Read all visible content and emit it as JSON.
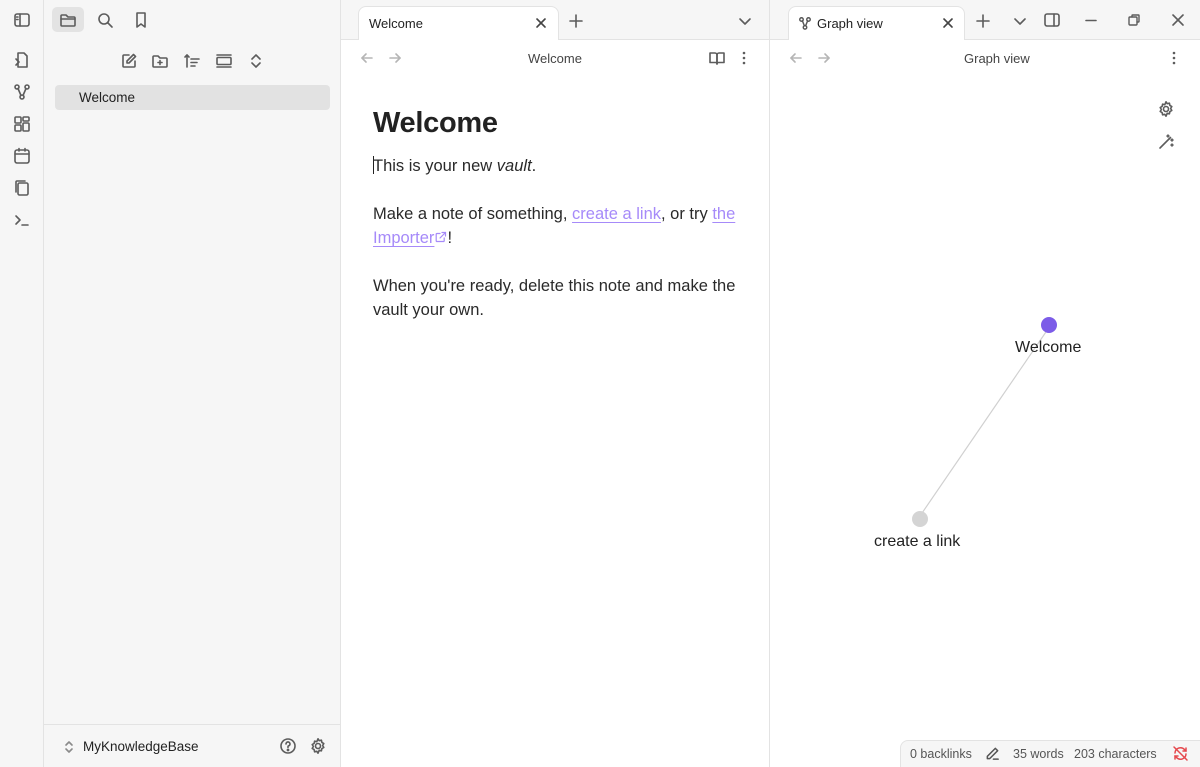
{
  "sidebar": {
    "files": [
      "Welcome"
    ],
    "vault_name": "MyKnowledgeBase"
  },
  "editor": {
    "tab_title": "Welcome",
    "view_title": "Welcome",
    "heading": "Welcome",
    "p1_before": "This is your new ",
    "p1_em": "vault",
    "p1_after": ".",
    "p2_before": "Make a note of something, ",
    "p2_link1": "create a link",
    "p2_middle": ", or try ",
    "p2_link2": "the Importer",
    "p2_after": "!",
    "p3": "When you're ready, delete this note and make the vault your own."
  },
  "graph": {
    "tab_title": "Graph view",
    "view_title": "Graph view",
    "nodes": [
      {
        "label": "Welcome",
        "color": "#7c5ce8"
      },
      {
        "label": "create a link",
        "color": "#d4d4d4"
      }
    ]
  },
  "status": {
    "backlinks": "0 backlinks",
    "words": "35 words",
    "characters": "203 characters"
  },
  "colors": {
    "accent": "#7c5ce8",
    "link": "#a68af9",
    "sync_error": "#e5484d"
  }
}
